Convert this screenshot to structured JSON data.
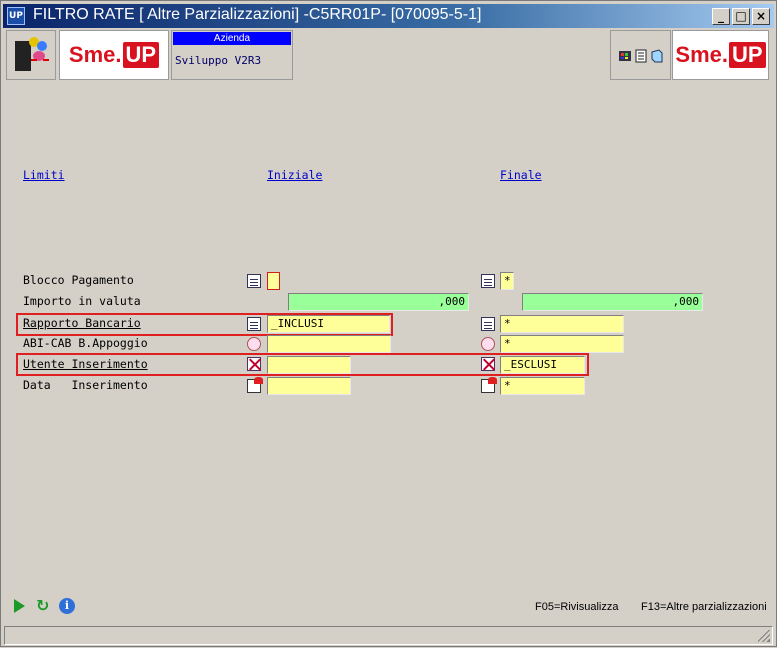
{
  "window": {
    "icon_text": "UP",
    "title": "FILTRO RATE [ Altre Parzializzazioni] -C5RR01P- [070095-5-1]",
    "controls": {
      "minimize": "_",
      "maximize": "□",
      "close": "×"
    }
  },
  "toolbar": {
    "logo_left": {
      "sme": "Sme.",
      "up": "UP"
    },
    "azienda": {
      "label": "Azienda",
      "value": "Sviluppo V2R3"
    },
    "logo_right": {
      "sme": "Sme.",
      "up": "UP"
    },
    "icons": [
      "palette-icon",
      "document-icon",
      "book-icon"
    ]
  },
  "columns": {
    "limiti": "Limiti",
    "iniziale": "Iniziale",
    "finale": "Finale"
  },
  "rows": [
    {
      "label": "Blocco Pagamento",
      "initial": "",
      "final": "*",
      "icon": "list-icon"
    },
    {
      "label": "Importo in valuta",
      "initial": ",000",
      "final": ",000"
    },
    {
      "label": "Rapporto Bancario",
      "initial": "_INCLUSI",
      "final": "*",
      "icon": "list-icon"
    },
    {
      "label": "ABI-CAB B.Appoggio",
      "initial": "",
      "final": "*",
      "icon": "clock-icon"
    },
    {
      "label": "Utente Inserimento",
      "initial": "",
      "final": "_ESCLUSI",
      "icon": "x-icon"
    },
    {
      "label": "Data   Inserimento",
      "initial": "",
      "final": "*",
      "icon": "calendar-icon"
    }
  ],
  "footer": {
    "f05": "F05=Rivisualizza",
    "f13": "F13=Altre parzializzazioni"
  },
  "colors": {
    "field_yellow": "#ffff99",
    "field_green": "#99ff99",
    "highlight": "#e02020",
    "title_bar": "#0a246a"
  }
}
